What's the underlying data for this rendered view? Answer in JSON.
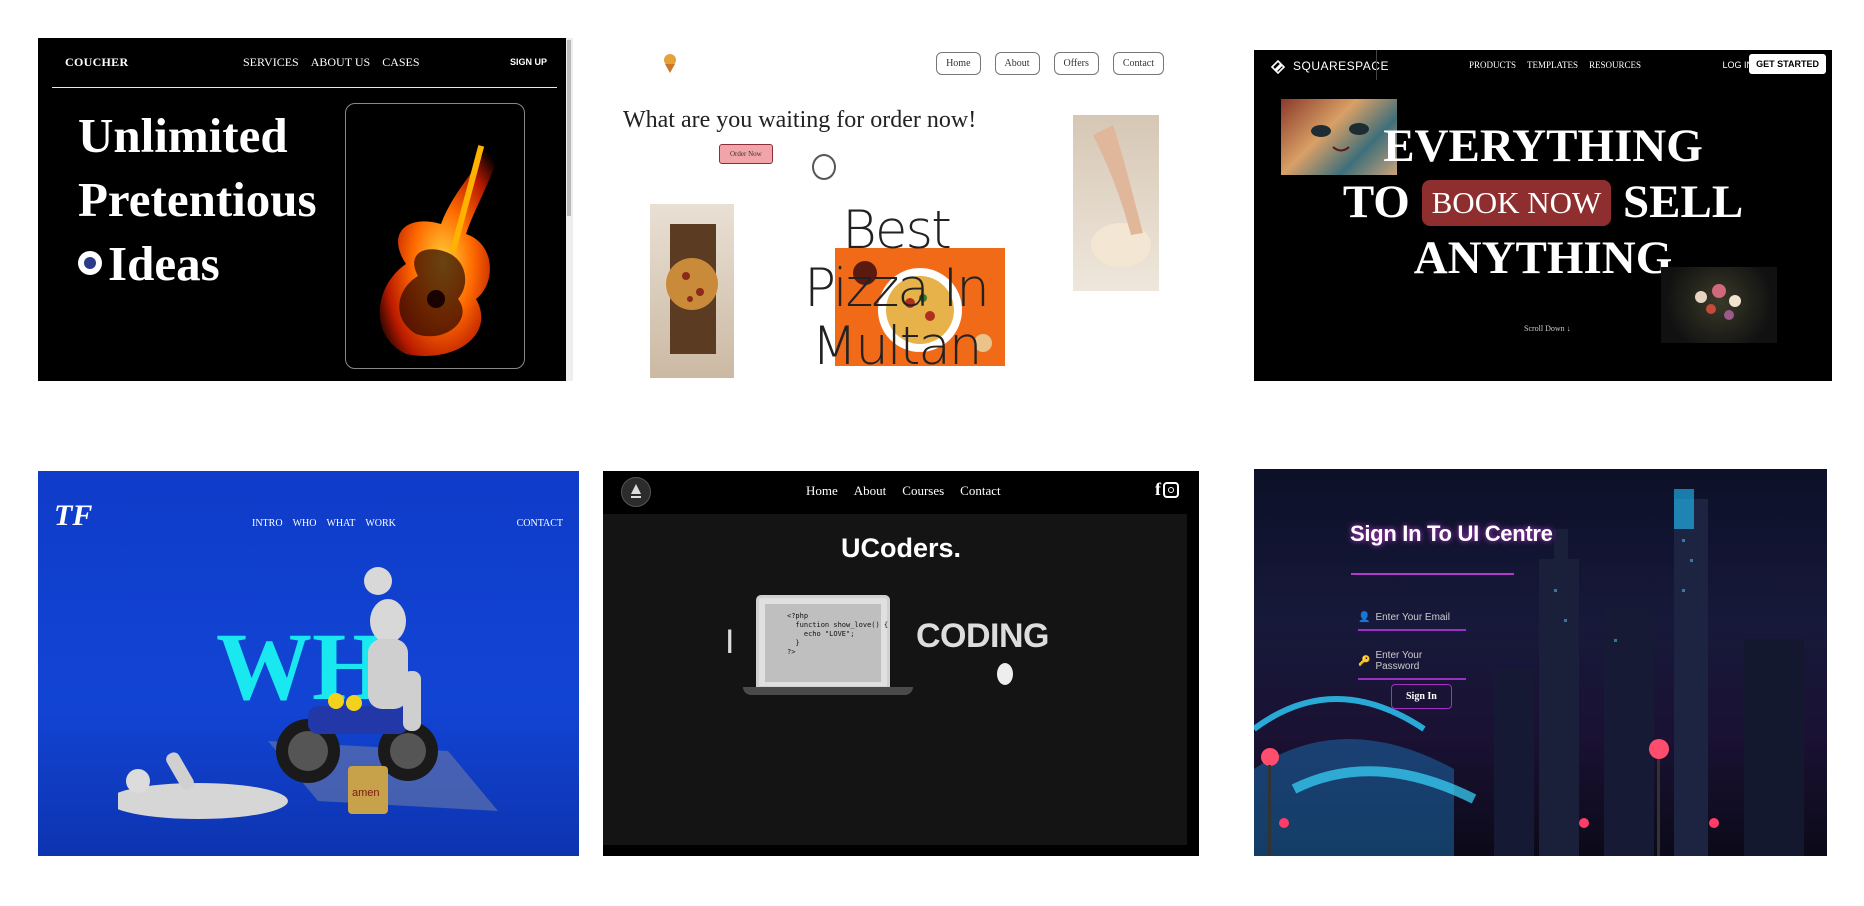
{
  "card1": {
    "logo": "COUCHER",
    "nav": [
      "SERVICES",
      "ABOUT US",
      "CASES"
    ],
    "signup": "SIGN UP",
    "headline": [
      "Unlimited",
      "Pretentious",
      "Ideas"
    ]
  },
  "card2": {
    "nav": [
      "Home",
      "About",
      "Offers",
      "Contact"
    ],
    "question": "What are you waiting for order now!",
    "order_button": "Order Now",
    "headline": [
      "Best Pizza In",
      "Multan"
    ]
  },
  "card3": {
    "brand": "SQUARESPACE",
    "nav": [
      "PRODUCTS",
      "TEMPLATES",
      "RESOURCES"
    ],
    "login": "LOG IN",
    "get_started": "GET STARTED",
    "line1": "EVERYTHING",
    "line2_left": "TO",
    "book_now": "BOOK NOW",
    "line2_right": "SELL",
    "line3": "ANYTHING",
    "scroll_down": "Scroll Down ↓"
  },
  "card4": {
    "logo": "TF",
    "nav": [
      "INTRO",
      "WHO",
      "WHAT",
      "WORK"
    ],
    "contact": "CONTACT",
    "big_text": "WH"
  },
  "card5": {
    "nav": [
      "Home",
      "About",
      "Courses",
      "Contact"
    ],
    "title": "UCoders.",
    "left_char": "I",
    "right_word": "CODING",
    "code": [
      "<?php",
      "  function show_love() {",
      "    echo \"LOVE\";",
      "  }",
      "?>"
    ]
  },
  "card6": {
    "title": "Sign In To UI Centre",
    "email_placeholder": "Enter Your Email",
    "password_placeholder": "Enter Your Password",
    "signin": "Sign In"
  }
}
